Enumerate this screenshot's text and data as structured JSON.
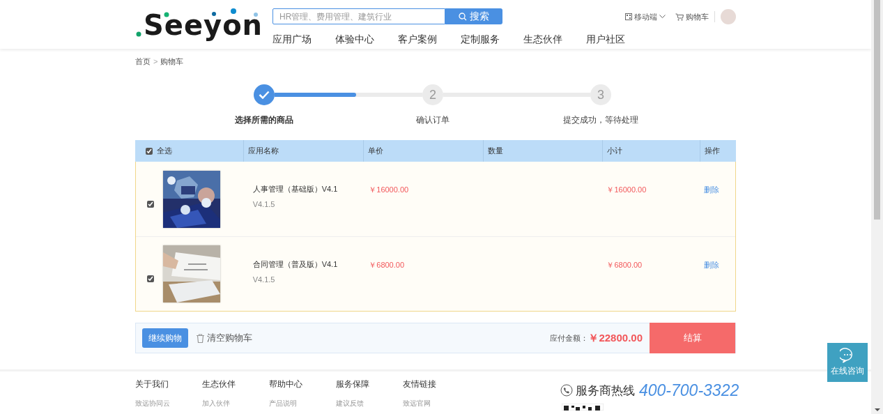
{
  "header": {
    "logo": "Seeyon",
    "search": {
      "placeholder": "HR管理、费用管理、建筑行业",
      "button": "搜索"
    },
    "links": [
      {
        "kind": "mobile",
        "label": "移动端"
      },
      {
        "kind": "cart",
        "label": "购物车"
      }
    ],
    "nav": [
      "应用广场",
      "体验中心",
      "客户案例",
      "定制服务",
      "生态伙伴",
      "用户社区"
    ]
  },
  "breadcrumb": [
    "首页",
    ">",
    "购物车"
  ],
  "steps": {
    "level": 0.55,
    "items": [
      {
        "label": "选择所需的商品",
        "done": true
      },
      {
        "label": "确认订单",
        "number": "2",
        "done": false
      },
      {
        "label": "提交成功，等待处理",
        "number": "3",
        "done": false
      }
    ]
  },
  "table": {
    "select_all": {
      "label": "全选",
      "checked": true
    },
    "columns": [
      "应用名称",
      "单价",
      "数量",
      "小计",
      "操作"
    ],
    "rows": [
      {
        "checked": true,
        "name": "人事管理（基础版）V4.1",
        "version": "V4.1.5",
        "price": "￥16000.00",
        "subtotal": "￥16000.00",
        "action": "删除"
      },
      {
        "checked": true,
        "name": "合同管理（普及版）V4.1",
        "version": "V4.1.5",
        "price": "￥6800.00",
        "subtotal": "￥6800.00",
        "action": "删除"
      }
    ]
  },
  "cart_bar": {
    "continue": "继续购物",
    "clear": "清空购物车",
    "total_label": "应付金额：",
    "total": "￥22800.00",
    "checkout": "结算"
  },
  "footer": {
    "columns": [
      {
        "title": "关于我们",
        "link": "致远协同云"
      },
      {
        "title": "生态伙伴",
        "link": "加入伙伴"
      },
      {
        "title": "帮助中心",
        "link": "产品说明"
      },
      {
        "title": "服务保障",
        "link": "建议反馈"
      },
      {
        "title": "友情链接",
        "link": "致远官网"
      }
    ],
    "hotline_label": "服务商热线",
    "hotline": "400-700-3322"
  },
  "chat": {
    "label": "在线咨询"
  }
}
